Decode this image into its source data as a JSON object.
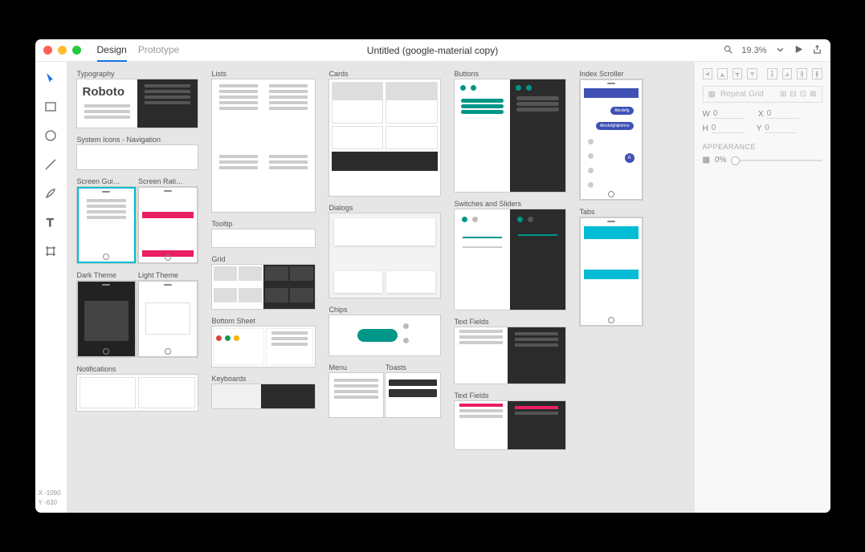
{
  "header": {
    "tabs": {
      "design": "Design",
      "prototype": "Prototype"
    },
    "title": "Untitled (google-material copy)",
    "zoom": "19.3%"
  },
  "coords": {
    "x_label": "X",
    "x": "-1090",
    "y_label": "Y",
    "y": "-630"
  },
  "artboards": {
    "typography": "Typography",
    "sysicons": "System Icons - Navigation",
    "screen_gui": "Screen Gui…",
    "screen_rati": "Screen Rati…",
    "dark_theme": "Dark Theme",
    "light_theme": "Light Theme",
    "notifications": "Notifications",
    "lists": "Lists",
    "tooltip": "Tooltip",
    "grid": "Grid",
    "bottom_sheet": "Bottom Sheet",
    "keyboards": "Keyboards",
    "cards": "Cards",
    "dialogs": "Dialogs",
    "chips": "Chips",
    "menu": "Menu",
    "toasts": "Toasts",
    "buttons": "Buttons",
    "switches": "Switches and Sliders",
    "text_fields": "Text Fields",
    "text_fields2": "Text Fields",
    "index_scroller": "Index Scroller",
    "tabs": "Tabs",
    "roboto": "Roboto"
  },
  "inspector": {
    "repeat": "Repeat Grid",
    "w": "W",
    "w_val": "0",
    "x": "X",
    "x_val": "0",
    "h": "H",
    "h_val": "0",
    "y": "Y",
    "y_val": "0",
    "appearance": "Appearance",
    "opacity": "0%"
  }
}
